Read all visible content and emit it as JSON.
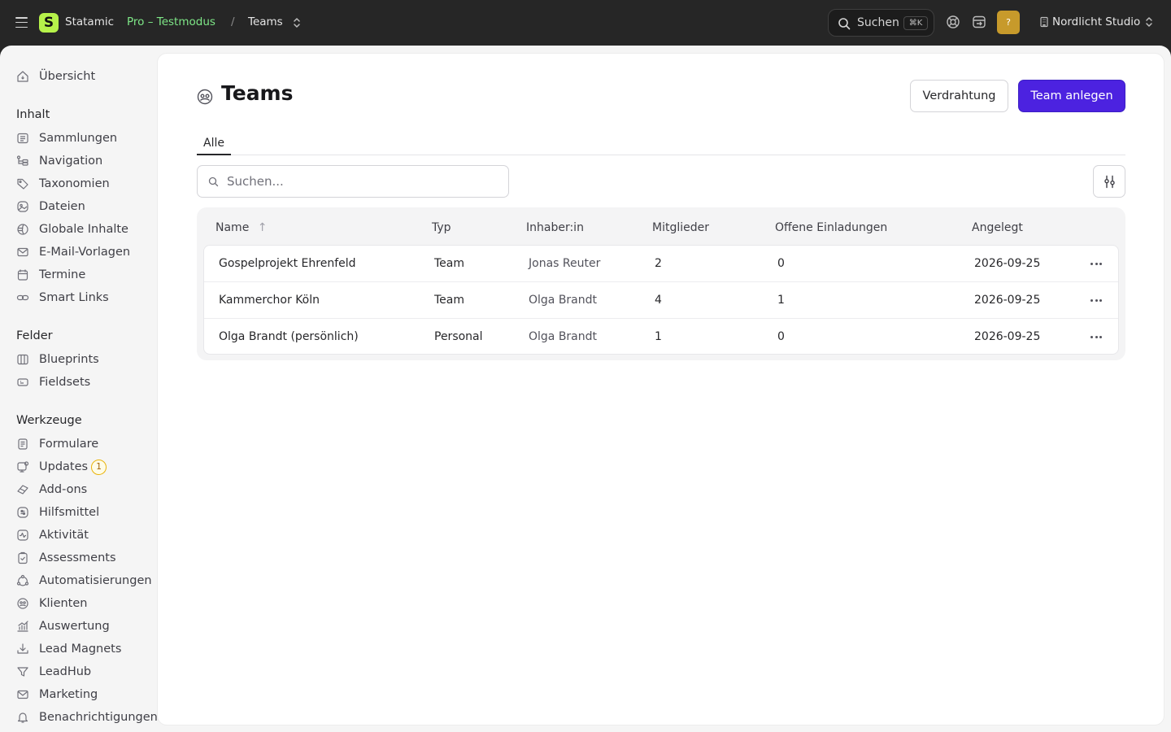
{
  "topbar": {
    "logo_letter": "S",
    "brand": "Statamic",
    "edition": "Pro – Testmodus",
    "separator": "/",
    "breadcrumb": "Teams",
    "search_label": "Suchen",
    "search_shortcut": "⌘K",
    "help_badge": "?",
    "site_name": "Nordlicht Studio"
  },
  "sidebar": {
    "overview": "Übersicht",
    "sections": [
      {
        "heading": "Inhalt",
        "items": [
          {
            "label": "Sammlungen",
            "icon": "collections-icon"
          },
          {
            "label": "Navigation",
            "icon": "navigation-icon"
          },
          {
            "label": "Taxonomien",
            "icon": "tag-icon"
          },
          {
            "label": "Dateien",
            "icon": "assets-icon"
          },
          {
            "label": "Globale Inhalte",
            "icon": "globe-icon"
          },
          {
            "label": "E-Mail-Vorlagen",
            "icon": "mail-icon"
          },
          {
            "label": "Termine",
            "icon": "calendar-icon"
          },
          {
            "label": "Smart Links",
            "icon": "link-icon"
          }
        ]
      },
      {
        "heading": "Felder",
        "items": [
          {
            "label": "Blueprints",
            "icon": "blueprint-icon"
          },
          {
            "label": "Fieldsets",
            "icon": "fieldset-icon"
          }
        ]
      },
      {
        "heading": "Werkzeuge",
        "items": [
          {
            "label": "Formulare",
            "icon": "forms-icon"
          },
          {
            "label": "Updates",
            "icon": "updates-icon",
            "badge": "1"
          },
          {
            "label": "Add-ons",
            "icon": "addons-icon"
          },
          {
            "label": "Hilfsmittel",
            "icon": "utilities-icon"
          },
          {
            "label": "Aktivität",
            "icon": "activity-icon"
          },
          {
            "label": "Assessments",
            "icon": "assessments-icon"
          },
          {
            "label": "Automatisierungen",
            "icon": "automation-icon"
          },
          {
            "label": "Klienten",
            "icon": "clients-icon"
          },
          {
            "label": "Auswertung",
            "icon": "analytics-icon"
          },
          {
            "label": "Lead Magnets",
            "icon": "download-icon"
          },
          {
            "label": "LeadHub",
            "icon": "filter-icon"
          },
          {
            "label": "Marketing",
            "icon": "mail-icon"
          },
          {
            "label": "Benachrichtigungen",
            "icon": "bell-icon"
          }
        ]
      }
    ]
  },
  "page": {
    "title": "Teams",
    "wiring_button": "Verdrahtung",
    "create_button": "Team anlegen",
    "tab_all": "Alle",
    "search_placeholder": "Suchen..."
  },
  "table": {
    "columns": [
      "Name",
      "Typ",
      "Inhaber:in",
      "Mitglieder",
      "Offene Einladungen",
      "Angelegt"
    ],
    "sort_arrow": "↑",
    "rows": [
      {
        "name": "Gospelprojekt Ehrenfeld",
        "type": "Team",
        "owner": "Jonas Reuter",
        "members": "2",
        "invites": "0",
        "created": "2026-09-25"
      },
      {
        "name": "Kammerchor Köln",
        "type": "Team",
        "owner": "Olga Brandt",
        "members": "4",
        "invites": "1",
        "created": "2026-09-25"
      },
      {
        "name": "Olga Brandt (persönlich)",
        "type": "Personal",
        "owner": "Olga Brandt",
        "members": "1",
        "invites": "0",
        "created": "2026-09-25"
      }
    ]
  },
  "colors": {
    "topbar": "#262626",
    "brand_green": "#b6f24a",
    "edition_green": "#7ee787",
    "primary": "#4c22e0",
    "badge_yellow": "#eab308",
    "help_gold": "#c79a2b"
  }
}
